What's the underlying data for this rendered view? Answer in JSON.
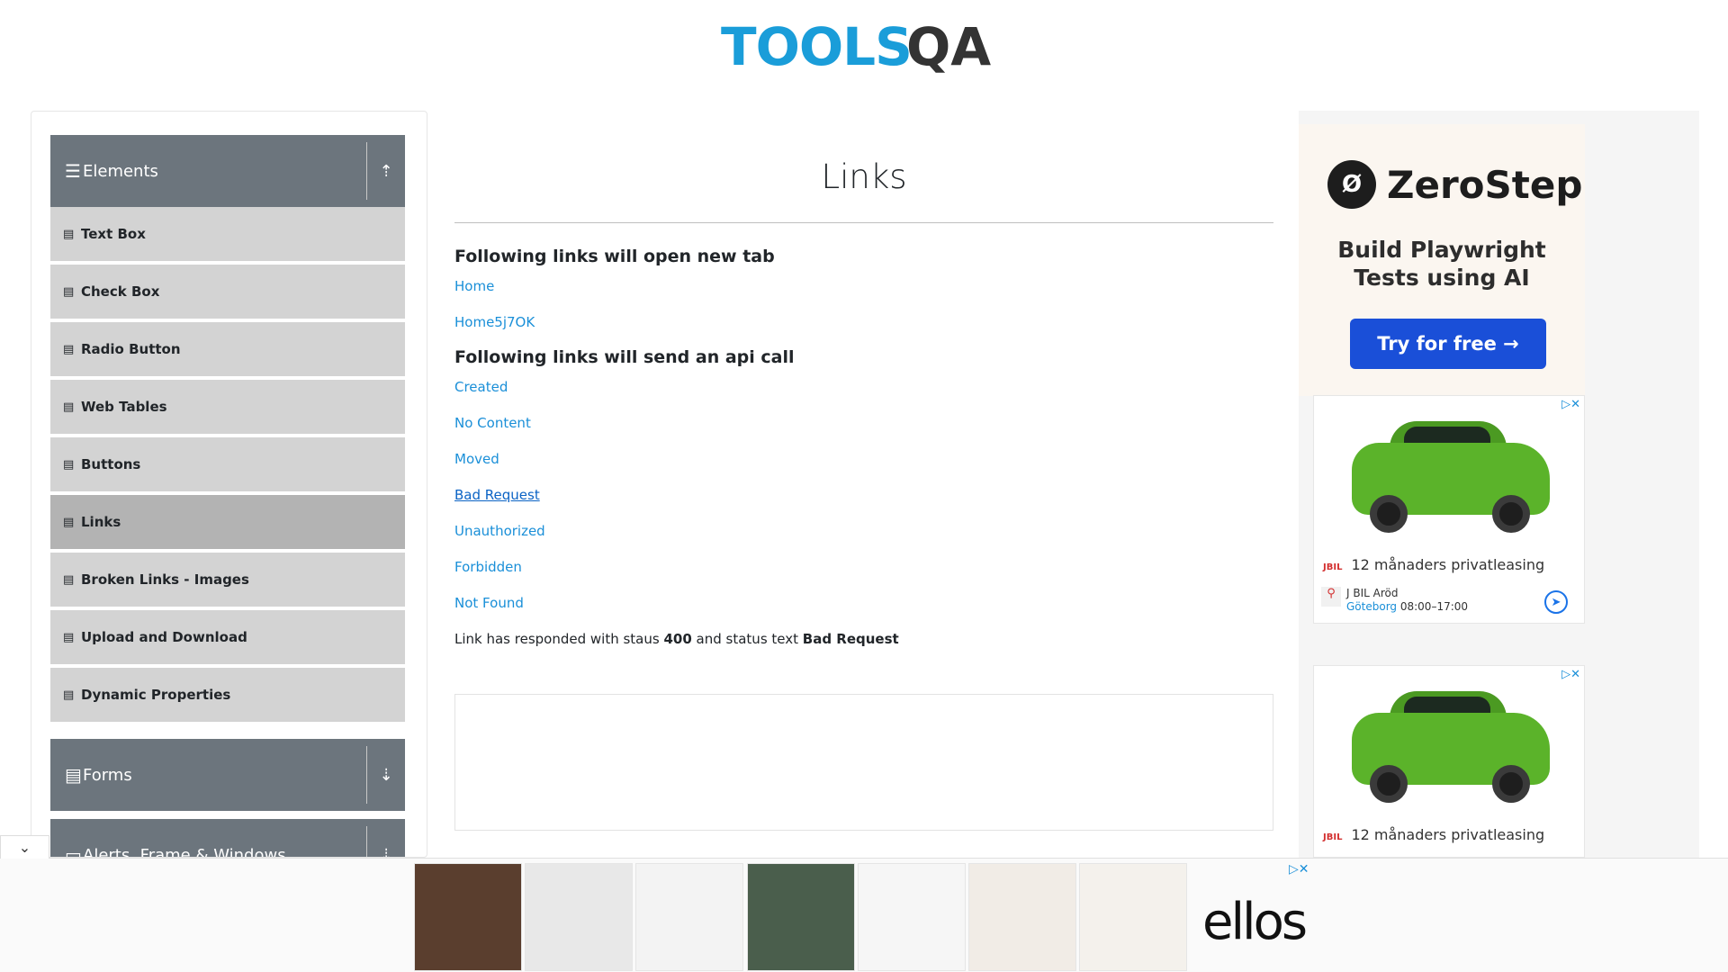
{
  "header": {
    "logo_main": "TOOLS",
    "logo_qa": "QA"
  },
  "sidebar": {
    "groups": [
      {
        "label": "Elements",
        "icon": "hamburger-icon",
        "toggle": "collapse-up-icon"
      },
      {
        "label": "Forms",
        "icon": "document-icon",
        "toggle": "expand-down-icon"
      },
      {
        "label": "Alerts, Frame & Windows",
        "icon": "window-icon",
        "toggle": "expand-down-icon"
      }
    ],
    "items": [
      {
        "label": "Text Box"
      },
      {
        "label": "Check Box"
      },
      {
        "label": "Radio Button"
      },
      {
        "label": "Web Tables"
      },
      {
        "label": "Buttons"
      },
      {
        "label": "Links",
        "active": true
      },
      {
        "label": "Broken Links - Images"
      },
      {
        "label": "Upload and Download"
      },
      {
        "label": "Dynamic Properties"
      }
    ]
  },
  "main": {
    "title": "Links",
    "section_new_tab": "Following links will open new tab",
    "new_tab_links": [
      "Home",
      "Home5j7OK"
    ],
    "section_api": "Following links will send an api call",
    "api_links": [
      "Created",
      "No Content",
      "Moved",
      "Bad Request",
      "Unauthorized",
      "Forbidden",
      "Not Found"
    ],
    "response": {
      "prefix": "Link has responded with staus ",
      "status": "400",
      "middle": " and status text ",
      "status_text": "Bad Request"
    }
  },
  "ads": {
    "zerostep": {
      "name": "ZeroStep",
      "tagline_1": "Build Playwright",
      "tagline_2": "Tests using AI",
      "button": "Try for free →"
    },
    "car_ad_1": {
      "brand": "JBIL",
      "headline": "12 månaders privatleasing",
      "dealer": "J BIL Aröd",
      "city": "Göteborg",
      "hours": "08:00–17:00"
    },
    "car_ad_2": {
      "brand": "JBIL",
      "headline": "12 månaders privatleasing"
    },
    "bottom": {
      "brand": "ellos"
    }
  },
  "colors": {
    "accent_blue": "#1a9dd9",
    "sidebar_header": "#6c757d",
    "menu_item": "#d3d3d3",
    "menu_item_active": "#b3b3b3",
    "link": "#1a8fd8",
    "zerostep_button": "#1a4fd8"
  }
}
